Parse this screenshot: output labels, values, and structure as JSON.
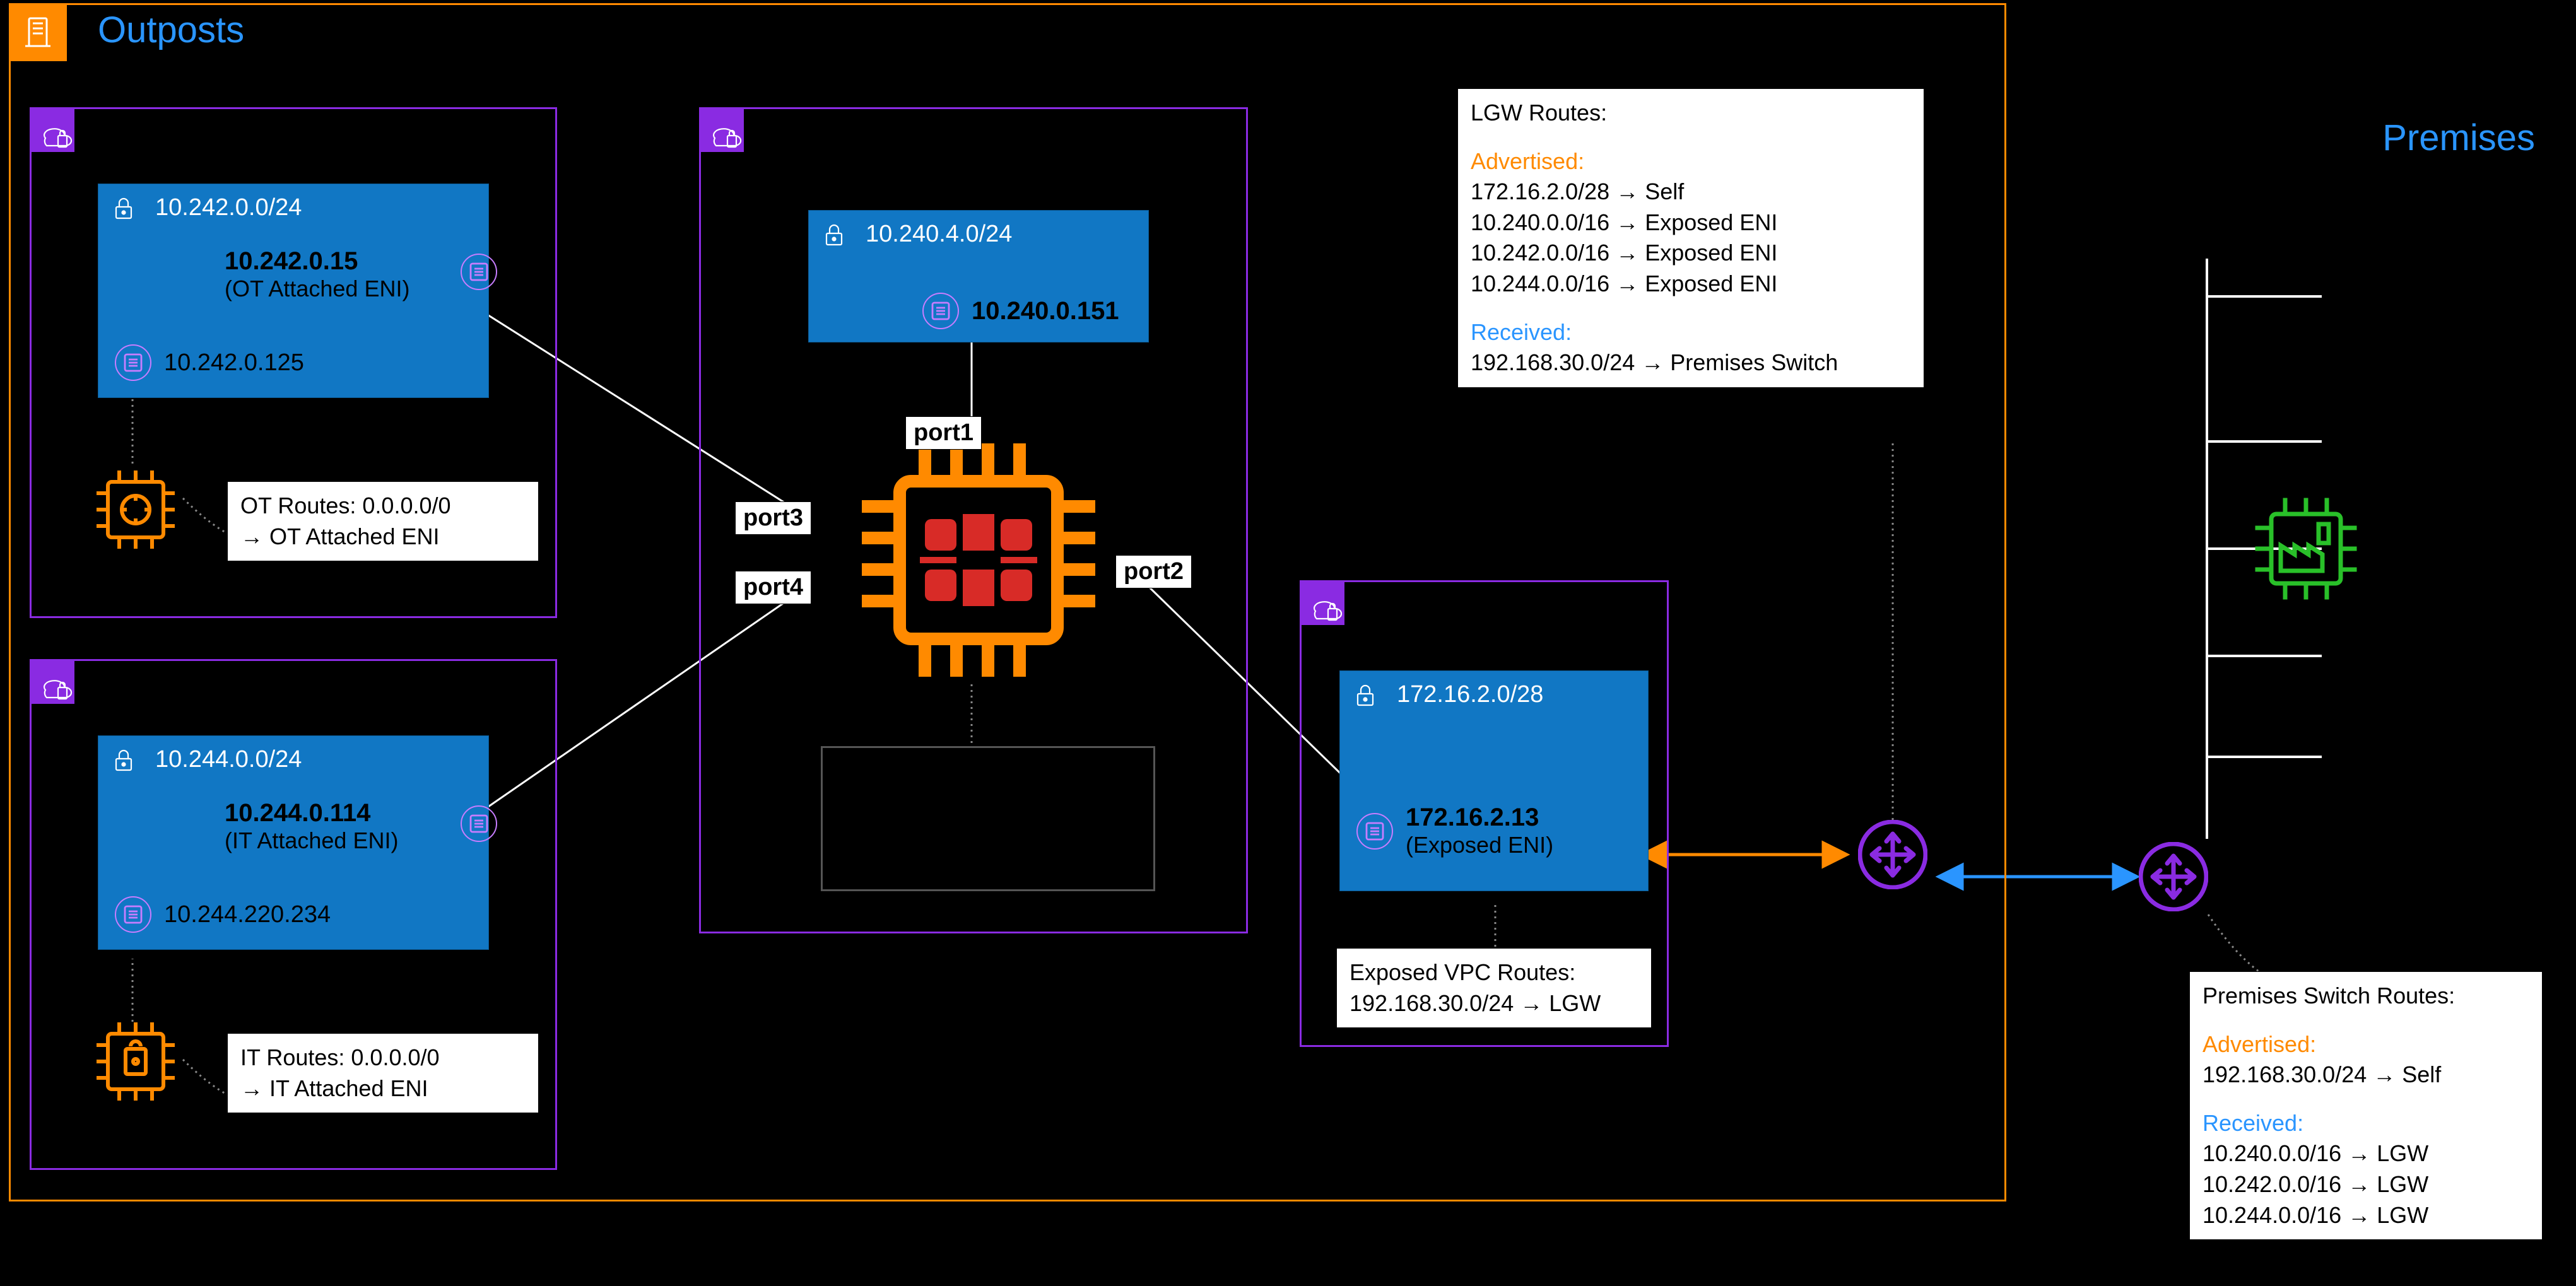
{
  "outposts": {
    "title": "Outposts"
  },
  "premises": {
    "title": "Premises"
  },
  "ot": {
    "cidr": "10.242.0.0/24",
    "eni_primary_ip": "10.242.0.15",
    "eni_primary_label": "(OT Attached ENI)",
    "eni_secondary_ip": "10.242.0.125",
    "routes_title": "OT Routes: 0.0.0.0/0",
    "routes_line2": "→ OT Attached ENI"
  },
  "it": {
    "cidr": "10.244.0.0/24",
    "eni_primary_ip": "10.244.0.114",
    "eni_primary_label": "(IT Attached ENI)",
    "eni_secondary_ip": "10.244.220.234",
    "routes_title": "IT Routes: 0.0.0.0/0",
    "routes_line2": "→ IT Attached ENI"
  },
  "fw": {
    "cidr": "10.240.4.0/24",
    "eni_ip": "10.240.0.151",
    "port1": "port1",
    "port2": "port2",
    "port3": "port3",
    "port4": "port4"
  },
  "exposed": {
    "cidr": "172.16.2.0/28",
    "eni_ip": "172.16.2.13",
    "eni_label": "(Exposed ENI)",
    "routes_title": "Exposed VPC Routes:",
    "routes_line2": "192.168.30.0/24 → LGW"
  },
  "lgw": {
    "title": "LGW Routes:",
    "adv_label": "Advertised:",
    "adv1": "172.16.2.0/28 → Self",
    "adv2": "10.240.0.0/16 → Exposed ENI",
    "adv3": "10.242.0.0/16 → Exposed ENI",
    "adv4": "10.244.0.0/16 → Exposed ENI",
    "recv_label": "Received:",
    "recv1": "192.168.30.0/24 → Premises Switch"
  },
  "premises_routes": {
    "title": "Premises Switch Routes:",
    "adv_label": "Advertised:",
    "adv1": "192.168.30.0/24 → Self",
    "recv_label": "Received:",
    "recv1": "10.240.0.0/16 → LGW",
    "recv2": "10.242.0.0/16 → LGW",
    "recv3": "10.244.0.0/16 → LGW"
  }
}
